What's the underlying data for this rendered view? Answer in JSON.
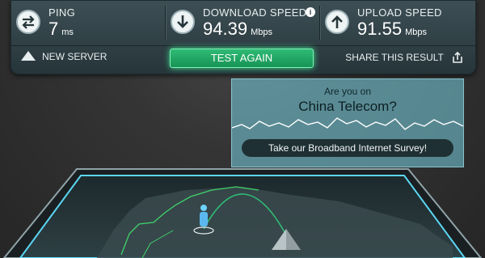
{
  "stats": {
    "ping": {
      "label": "PING",
      "value": "7",
      "unit": "ms"
    },
    "download": {
      "label": "DOWNLOAD SPEED",
      "value": "94.39",
      "unit": "Mbps"
    },
    "upload": {
      "label": "UPLOAD SPEED",
      "value": "91.55",
      "unit": "Mbps"
    }
  },
  "actions": {
    "new_server": "NEW SERVER",
    "test_again": "TEST AGAIN",
    "share": "SHARE THIS RESULT"
  },
  "info_glyph": "i",
  "survey": {
    "line1": "Are you on",
    "line2": "China Telecom?",
    "button": "Take our Broadband Internet Survey!"
  },
  "colors": {
    "accent_green": "#2fbb74",
    "survey_bg": "#78d2e1",
    "map_border": "#5fe0ff"
  },
  "icons": [
    "swap-arrows-icon",
    "download-arrow-icon",
    "info-icon",
    "upload-arrow-icon",
    "triangle-icon",
    "share-icon",
    "person-marker-icon",
    "server-marker-icon"
  ]
}
